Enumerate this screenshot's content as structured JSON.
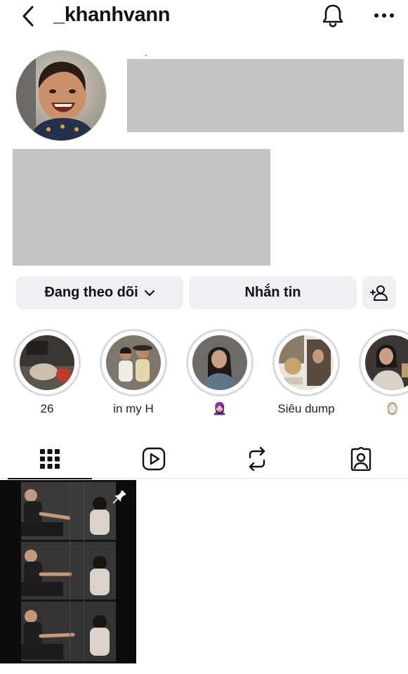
{
  "header": {
    "username": "_khanhvann",
    "back_icon": "chevron-left-icon",
    "bell_icon": "bell-icon",
    "more_icon": "more-horizontal-icon"
  },
  "profile": {
    "stray_mark": "`"
  },
  "actions": {
    "following_label": "Đang theo dõi",
    "message_label": "Nhắn tin",
    "add_person_icon": "add-person-icon"
  },
  "highlights": [
    {
      "label": "26"
    },
    {
      "label": "in my H"
    },
    {
      "label": "🧕🏻"
    },
    {
      "label": "Siêu dump"
    },
    {
      "label": "🪞"
    }
  ],
  "tabs": [
    {
      "icon": "grid-icon",
      "active": true
    },
    {
      "icon": "reels-icon",
      "active": false
    },
    {
      "icon": "reposts-icon",
      "active": false
    },
    {
      "icon": "tagged-icon",
      "active": false
    }
  ],
  "posts": [
    {
      "pinned": true,
      "pin_icon": "pin-icon"
    }
  ]
}
